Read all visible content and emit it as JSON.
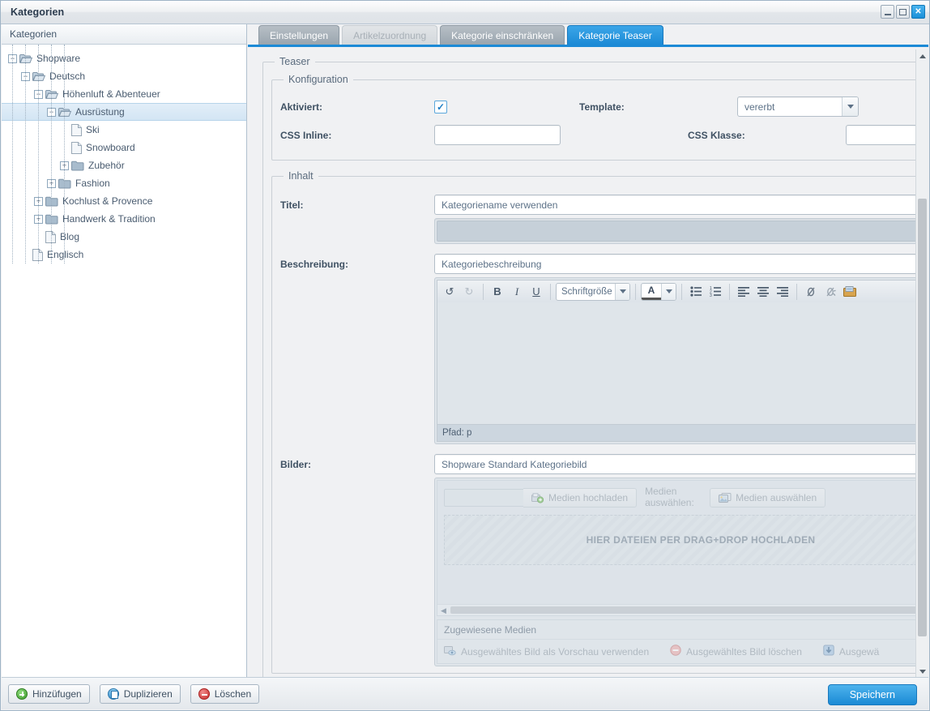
{
  "window": {
    "title": "Kategorien",
    "minimize_label": "_",
    "maximize_label": "□",
    "close_label": "✕"
  },
  "left_panel": {
    "header": "Kategorien",
    "tree": [
      {
        "label": "Shopware",
        "depth": 0,
        "toggle": "minus",
        "icon": "folder-open"
      },
      {
        "label": "Deutsch",
        "depth": 1,
        "toggle": "minus",
        "icon": "folder-open"
      },
      {
        "label": "Höhenluft & Abenteuer",
        "depth": 2,
        "toggle": "minus",
        "icon": "folder-open"
      },
      {
        "label": "Ausrüstung",
        "depth": 3,
        "toggle": "minus",
        "icon": "folder-open",
        "selected": true
      },
      {
        "label": "Ski",
        "depth": 4,
        "toggle": "none",
        "icon": "document"
      },
      {
        "label": "Snowboard",
        "depth": 4,
        "toggle": "none",
        "icon": "document"
      },
      {
        "label": "Zubehör",
        "depth": 4,
        "toggle": "plus",
        "icon": "folder"
      },
      {
        "label": "Fashion",
        "depth": 3,
        "toggle": "plus",
        "icon": "folder"
      },
      {
        "label": "Kochlust & Provence",
        "depth": 2,
        "toggle": "plus",
        "icon": "folder"
      },
      {
        "label": "Handwerk & Tradition",
        "depth": 2,
        "toggle": "plus",
        "icon": "folder"
      },
      {
        "label": "Blog",
        "depth": 2,
        "toggle": "none",
        "icon": "document"
      },
      {
        "label": "Englisch",
        "depth": 1,
        "toggle": "none",
        "icon": "document"
      }
    ],
    "buttons": [
      {
        "label": "Hinzüfugen",
        "icon": "plus-circle-icon"
      },
      {
        "label": "Duplizieren",
        "icon": "duplicate-icon"
      },
      {
        "label": "Löschen",
        "icon": "minus-circle-icon"
      }
    ]
  },
  "tabs": [
    {
      "label": "Einstellungen",
      "state": "normal"
    },
    {
      "label": "Artikelzuordnung",
      "state": "disabled"
    },
    {
      "label": "Kategorie einschränken",
      "state": "normal"
    },
    {
      "label": "Kategorie Teaser",
      "state": "active"
    }
  ],
  "teaser": {
    "legend": "Teaser",
    "konfiguration": {
      "legend": "Konfiguration",
      "aktiviert_label": "Aktiviert:",
      "aktiviert_checked": "✓",
      "template_label": "Template:",
      "template_value": "vererbt",
      "css_inline_label": "CSS Inline:",
      "css_inline_value": "",
      "css_klasse_label": "CSS Klasse:",
      "css_klasse_value": ""
    },
    "inhalt": {
      "legend": "Inhalt",
      "titel_label": "Titel:",
      "titel_value": "Kategoriename verwenden",
      "titel_text_value": "",
      "beschreibung_label": "Beschreibung:",
      "beschreibung_value": "Kategoriebeschreibung",
      "bilder_label": "Bilder:",
      "bilder_value": "Shopware Standard Kategoriebild"
    },
    "editor": {
      "undo": "↺",
      "redo": "↻",
      "bold": "B",
      "italic": "I",
      "underline": "U",
      "fontsize_value": "Schriftgröße",
      "fontcolor": "A",
      "bullet_list": "bullet-list-icon",
      "numbered_list": "numbered-list-icon",
      "align_left": "align-left-icon",
      "align_center": "align-center-icon",
      "align_right": "align-right-icon",
      "link": "link-icon",
      "unlink": "unlink-icon",
      "image": "insert-image-icon",
      "status": "Pfad: p",
      "body_text": ""
    },
    "media": {
      "upload_input_value": "",
      "upload_button": "Medien hochladen",
      "select_label": "Medien auswählen:",
      "select_button": "Medien auswählen",
      "dropzone": "HIER DATEIEN PER DRAG+DROP HOCHLADEN",
      "assigned_header": "Zugewiesene Medien",
      "actions": [
        {
          "label": "Ausgewähltes Bild als Vorschau verwenden",
          "icon": "preview-icon"
        },
        {
          "label": "Ausgewähltes Bild löschen",
          "icon": "minus-circle-icon"
        },
        {
          "label": "Ausgewä",
          "icon": "download-icon"
        }
      ]
    }
  },
  "footer": {
    "save_label": "Speichern"
  },
  "colors": {
    "accent": "#1c8ad6",
    "tab_active": "#1c8ad6",
    "tree_selected": "#d3e5f4",
    "text": "#3c4b5e"
  }
}
